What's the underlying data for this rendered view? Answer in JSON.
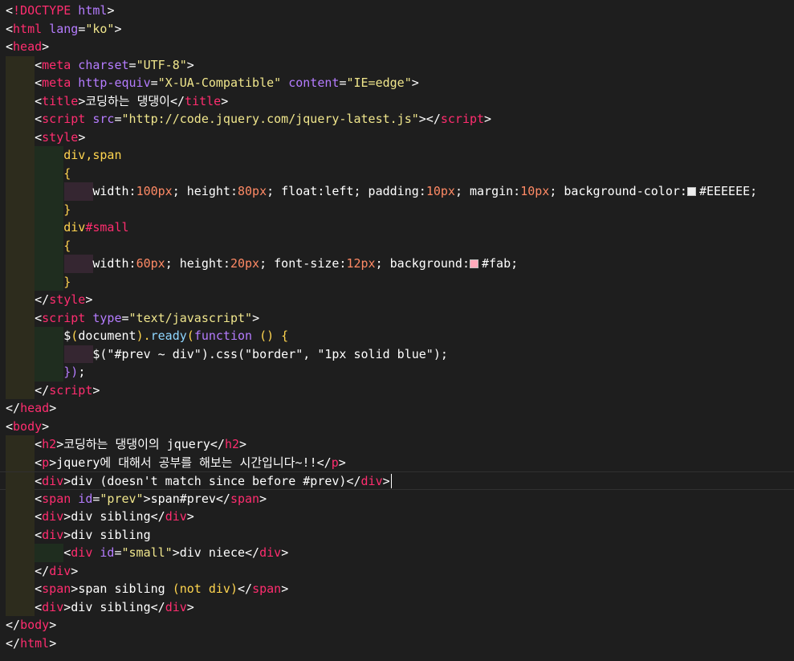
{
  "editor": {
    "lines": [
      {
        "segments": [
          {
            "t": "<",
            "c": "punc"
          },
          {
            "t": "!DOCTYPE",
            "c": "tag"
          },
          {
            "t": " html",
            "c": "attr"
          },
          {
            "t": ">",
            "c": "punc"
          }
        ]
      },
      {
        "segments": [
          {
            "t": "<",
            "c": "punc"
          },
          {
            "t": "html",
            "c": "tag"
          },
          {
            "t": " lang",
            "c": "attr"
          },
          {
            "t": "=",
            "c": "punc"
          },
          {
            "t": "\"ko\"",
            "c": "str"
          },
          {
            "t": ">",
            "c": "punc"
          }
        ]
      },
      {
        "segments": [
          {
            "t": "<",
            "c": "punc"
          },
          {
            "t": "head",
            "c": "tag"
          },
          {
            "t": ">",
            "c": "punc"
          }
        ]
      },
      {
        "indent": 1,
        "segments": [
          {
            "t": "    <",
            "c": "punc"
          },
          {
            "t": "meta",
            "c": "tag"
          },
          {
            "t": " charset",
            "c": "attr"
          },
          {
            "t": "=",
            "c": "punc"
          },
          {
            "t": "\"UTF-8\"",
            "c": "str"
          },
          {
            "t": ">",
            "c": "punc"
          }
        ]
      },
      {
        "indent": 1,
        "segments": [
          {
            "t": "    <",
            "c": "punc"
          },
          {
            "t": "meta",
            "c": "tag"
          },
          {
            "t": " http-equiv",
            "c": "attr"
          },
          {
            "t": "=",
            "c": "punc"
          },
          {
            "t": "\"X-UA-Compatible\"",
            "c": "str"
          },
          {
            "t": " content",
            "c": "attr"
          },
          {
            "t": "=",
            "c": "punc"
          },
          {
            "t": "\"IE=edge\"",
            "c": "str"
          },
          {
            "t": ">",
            "c": "punc"
          }
        ]
      },
      {
        "indent": 1,
        "segments": [
          {
            "t": "    <",
            "c": "punc"
          },
          {
            "t": "title",
            "c": "tag"
          },
          {
            "t": ">",
            "c": "punc"
          },
          {
            "t": "코딩하는 댕댕이",
            "c": "text"
          },
          {
            "t": "</",
            "c": "punc"
          },
          {
            "t": "title",
            "c": "tag"
          },
          {
            "t": ">",
            "c": "punc"
          }
        ]
      },
      {
        "indent": 1,
        "segments": [
          {
            "t": "    <",
            "c": "punc"
          },
          {
            "t": "script",
            "c": "tag"
          },
          {
            "t": " src",
            "c": "attr"
          },
          {
            "t": "=",
            "c": "punc"
          },
          {
            "t": "\"http://code.jquery.com/jquery-latest.js\"",
            "c": "str"
          },
          {
            "t": "></",
            "c": "punc"
          },
          {
            "t": "script",
            "c": "tag"
          },
          {
            "t": ">",
            "c": "punc"
          }
        ]
      },
      {
        "indent": 1,
        "segments": [
          {
            "t": "    <",
            "c": "punc"
          },
          {
            "t": "style",
            "c": "tag"
          },
          {
            "t": ">",
            "c": "punc"
          }
        ]
      },
      {
        "indent": 2,
        "segments": [
          {
            "t": "        div,span",
            "c": "selector"
          }
        ]
      },
      {
        "indent": 2,
        "segments": [
          {
            "t": "        {",
            "c": "selector"
          }
        ]
      },
      {
        "indent": 3,
        "segments": [
          {
            "t": "            width:",
            "c": "prop"
          },
          {
            "t": "100px",
            "c": "num"
          },
          {
            "t": "; height:",
            "c": "prop"
          },
          {
            "t": "80px",
            "c": "num"
          },
          {
            "t": "; float:",
            "c": "prop"
          },
          {
            "t": "left",
            "c": "key"
          },
          {
            "t": "; padding:",
            "c": "prop"
          },
          {
            "t": "10px",
            "c": "num"
          },
          {
            "t": "; margin:",
            "c": "prop"
          },
          {
            "t": "10px",
            "c": "num"
          },
          {
            "t": "; background-color:",
            "c": "prop"
          },
          {
            "t": "#EEEEEE",
            "c": "swatch",
            "color": "#EEEEEE"
          },
          {
            "t": ";",
            "c": "prop"
          }
        ]
      },
      {
        "indent": 2,
        "segments": [
          {
            "t": "        }",
            "c": "selector"
          }
        ]
      },
      {
        "indent": 2,
        "segments": [
          {
            "t": "        div",
            "c": "selector"
          },
          {
            "t": "#small",
            "c": "tag"
          }
        ]
      },
      {
        "indent": 2,
        "segments": [
          {
            "t": "        {",
            "c": "selector"
          }
        ]
      },
      {
        "indent": 3,
        "segments": [
          {
            "t": "            width:",
            "c": "prop"
          },
          {
            "t": "60px",
            "c": "num"
          },
          {
            "t": "; height:",
            "c": "prop"
          },
          {
            "t": "20px",
            "c": "num"
          },
          {
            "t": "; font-size:",
            "c": "prop"
          },
          {
            "t": "12px",
            "c": "num"
          },
          {
            "t": "; background:",
            "c": "prop"
          },
          {
            "t": "#fab",
            "c": "swatch",
            "color": "#ffaabb"
          },
          {
            "t": ";",
            "c": "prop"
          }
        ]
      },
      {
        "indent": 2,
        "segments": [
          {
            "t": "        }",
            "c": "selector"
          }
        ]
      },
      {
        "indent": 1,
        "segments": [
          {
            "t": "    </",
            "c": "punc"
          },
          {
            "t": "style",
            "c": "tag"
          },
          {
            "t": ">",
            "c": "punc"
          }
        ]
      },
      {
        "indent": 1,
        "segments": [
          {
            "t": "    <",
            "c": "punc"
          },
          {
            "t": "script",
            "c": "tag"
          },
          {
            "t": " type",
            "c": "attr"
          },
          {
            "t": "=",
            "c": "punc"
          },
          {
            "t": "\"text/javascript\"",
            "c": "str"
          },
          {
            "t": ">",
            "c": "punc"
          }
        ]
      },
      {
        "indent": 2,
        "segments": [
          {
            "t": "        $",
            "c": "js"
          },
          {
            "t": "(",
            "c": "selector"
          },
          {
            "t": "document",
            "c": "js"
          },
          {
            "t": ").",
            "c": "selector"
          },
          {
            "t": "ready",
            "c": "func"
          },
          {
            "t": "(",
            "c": "selector"
          },
          {
            "t": "function",
            "c": "attr"
          },
          {
            "t": " () {",
            "c": "selector"
          }
        ]
      },
      {
        "indent": 3,
        "segments": [
          {
            "t": "            $(\"#prev ~ div\").css(\"border\", \"1px solid blue\");",
            "c": "str2"
          }
        ]
      },
      {
        "indent": 2,
        "segments": [
          {
            "t": "        })",
            "c": "attr"
          },
          {
            "t": ";",
            "c": "js"
          }
        ]
      },
      {
        "indent": 1,
        "segments": [
          {
            "t": "    </",
            "c": "punc"
          },
          {
            "t": "script",
            "c": "tag"
          },
          {
            "t": ">",
            "c": "punc"
          }
        ]
      },
      {
        "segments": [
          {
            "t": "</",
            "c": "punc"
          },
          {
            "t": "head",
            "c": "tag"
          },
          {
            "t": ">",
            "c": "punc"
          }
        ]
      },
      {
        "segments": [
          {
            "t": "<",
            "c": "punc"
          },
          {
            "t": "body",
            "c": "tag"
          },
          {
            "t": ">",
            "c": "punc"
          }
        ]
      },
      {
        "indent": 1,
        "segments": [
          {
            "t": "    <",
            "c": "punc"
          },
          {
            "t": "h2",
            "c": "tag"
          },
          {
            "t": ">",
            "c": "punc"
          },
          {
            "t": "코딩하는 댕댕이의 jquery",
            "c": "text"
          },
          {
            "t": "</",
            "c": "punc"
          },
          {
            "t": "h2",
            "c": "tag"
          },
          {
            "t": ">",
            "c": "punc"
          }
        ]
      },
      {
        "indent": 1,
        "segments": [
          {
            "t": "    <",
            "c": "punc"
          },
          {
            "t": "p",
            "c": "tag"
          },
          {
            "t": ">",
            "c": "punc"
          },
          {
            "t": "jquery에 대해서 공부를 해보는 시간입니다~!!",
            "c": "text"
          },
          {
            "t": "</",
            "c": "punc"
          },
          {
            "t": "p",
            "c": "tag"
          },
          {
            "t": ">",
            "c": "punc"
          }
        ]
      },
      {
        "indent": 1,
        "current": true,
        "segments": [
          {
            "t": "    <",
            "c": "punc"
          },
          {
            "t": "div",
            "c": "tag"
          },
          {
            "t": ">",
            "c": "punc"
          },
          {
            "t": "div (doesn't match since before #prev)",
            "c": "text"
          },
          {
            "t": "</",
            "c": "punc"
          },
          {
            "t": "div",
            "c": "tag"
          },
          {
            "t": ">",
            "c": "punc"
          }
        ]
      },
      {
        "indent": 1,
        "segments": [
          {
            "t": "    <",
            "c": "punc"
          },
          {
            "t": "span",
            "c": "tag"
          },
          {
            "t": " id",
            "c": "attr"
          },
          {
            "t": "=",
            "c": "punc"
          },
          {
            "t": "\"prev\"",
            "c": "str"
          },
          {
            "t": ">",
            "c": "punc"
          },
          {
            "t": "span#prev",
            "c": "text"
          },
          {
            "t": "</",
            "c": "punc"
          },
          {
            "t": "span",
            "c": "tag"
          },
          {
            "t": ">",
            "c": "punc"
          }
        ]
      },
      {
        "indent": 1,
        "segments": [
          {
            "t": "    <",
            "c": "punc"
          },
          {
            "t": "div",
            "c": "tag"
          },
          {
            "t": ">",
            "c": "punc"
          },
          {
            "t": "div sibling",
            "c": "text"
          },
          {
            "t": "</",
            "c": "punc"
          },
          {
            "t": "div",
            "c": "tag"
          },
          {
            "t": ">",
            "c": "punc"
          }
        ]
      },
      {
        "indent": 1,
        "segments": [
          {
            "t": "    <",
            "c": "punc"
          },
          {
            "t": "div",
            "c": "tag"
          },
          {
            "t": ">",
            "c": "punc"
          },
          {
            "t": "div sibling",
            "c": "text"
          }
        ]
      },
      {
        "indent": 2,
        "segments": [
          {
            "t": "        <",
            "c": "punc"
          },
          {
            "t": "div",
            "c": "tag"
          },
          {
            "t": " id",
            "c": "attr"
          },
          {
            "t": "=",
            "c": "punc"
          },
          {
            "t": "\"small\"",
            "c": "str"
          },
          {
            "t": ">",
            "c": "punc"
          },
          {
            "t": "div niece",
            "c": "text"
          },
          {
            "t": "</",
            "c": "punc"
          },
          {
            "t": "div",
            "c": "tag"
          },
          {
            "t": ">",
            "c": "punc"
          }
        ]
      },
      {
        "indent": 1,
        "segments": [
          {
            "t": "    </",
            "c": "punc"
          },
          {
            "t": "div",
            "c": "tag"
          },
          {
            "t": ">",
            "c": "punc"
          }
        ]
      },
      {
        "indent": 1,
        "segments": [
          {
            "t": "    <",
            "c": "punc"
          },
          {
            "t": "span",
            "c": "tag"
          },
          {
            "t": ">",
            "c": "punc"
          },
          {
            "t": "span sibling ",
            "c": "text"
          },
          {
            "t": "(not div)",
            "c": "selector"
          },
          {
            "t": "</",
            "c": "punc"
          },
          {
            "t": "span",
            "c": "tag"
          },
          {
            "t": ">",
            "c": "punc"
          }
        ]
      },
      {
        "indent": 1,
        "segments": [
          {
            "t": "    <",
            "c": "punc"
          },
          {
            "t": "div",
            "c": "tag"
          },
          {
            "t": ">",
            "c": "punc"
          },
          {
            "t": "div sibling",
            "c": "text"
          },
          {
            "t": "</",
            "c": "punc"
          },
          {
            "t": "div",
            "c": "tag"
          },
          {
            "t": ">",
            "c": "punc"
          }
        ]
      },
      {
        "segments": [
          {
            "t": "</",
            "c": "punc"
          },
          {
            "t": "body",
            "c": "tag"
          },
          {
            "t": ">",
            "c": "punc"
          }
        ]
      },
      {
        "segments": [
          {
            "t": "</",
            "c": "punc"
          },
          {
            "t": "html",
            "c": "tag"
          },
          {
            "t": ">",
            "c": "punc"
          }
        ]
      }
    ]
  },
  "colors": {
    "background": "#1e1e1e",
    "tag": "#ff2d6f",
    "attribute": "#b57cff",
    "string": "#f0e68c",
    "number": "#ff8a65",
    "selector": "#ffd54f",
    "function": "#8fd6ff"
  }
}
